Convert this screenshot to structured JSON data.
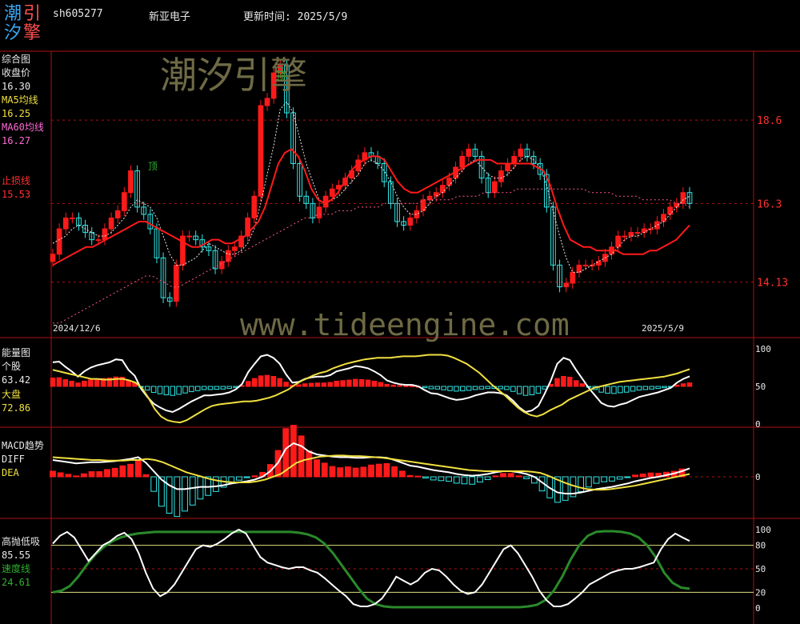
{
  "header": {
    "logo_chars": [
      "潮",
      "引",
      "汐",
      "擎"
    ],
    "code": "sh605277",
    "name": "新亚电子",
    "update": "更新时间: 2025/5/9"
  },
  "watermark": {
    "brand": "潮汐引擎",
    "url": "www.tideengine.com"
  },
  "colors": {
    "bull": "#ff1a1a",
    "bear": "#30e8e8",
    "ma5": "#e8e8e8",
    "ma60": "#ff3030",
    "grid": "#b01010",
    "bg": "#000000"
  },
  "panels": {
    "main": {
      "labels": [
        "综合图",
        "收盘价",
        "16.30",
        "MA5均线",
        "16.25",
        "MA60均线",
        "16.27",
        "止损线",
        "15.53"
      ],
      "top_marks": [
        "顶",
        "顶"
      ],
      "dates": [
        "2024/12/6",
        "2025/5/9"
      ]
    },
    "energy": {
      "labels": [
        "能量图",
        "个股",
        "63.42",
        "大盘",
        "72.86"
      ]
    },
    "macd": {
      "labels": [
        "MACD趋势",
        "DIFF",
        "DEA"
      ]
    },
    "osc": {
      "labels": [
        "高抛低吸",
        "85.55",
        "速度线",
        "24.61"
      ]
    }
  },
  "chart_data": [
    {
      "type": "candlestick",
      "title": "综合图",
      "y_ticks": [
        "18.6",
        "16.3",
        "14.13"
      ],
      "ylim": [
        12.6,
        20.5
      ],
      "x_labels": [
        "2024/12/6",
        "2025/5/9"
      ],
      "closes": [
        14.9,
        15.6,
        15.9,
        15.9,
        15.7,
        15.5,
        15.3,
        15.3,
        15.6,
        15.9,
        16.1,
        16.6,
        17.2,
        16.2,
        16.0,
        15.6,
        14.8,
        13.7,
        13.6,
        14.6,
        15.4,
        15.4,
        15.3,
        15.1,
        15.0,
        14.5,
        14.7,
        15.0,
        15.1,
        15.4,
        15.9,
        16.5,
        19.0,
        19.2,
        19.9,
        20.1,
        18.8,
        17.4,
        16.5,
        16.3,
        15.9,
        16.2,
        16.5,
        16.7,
        16.8,
        17.0,
        17.2,
        17.5,
        17.7,
        17.6,
        17.4,
        16.9,
        16.3,
        15.8,
        15.7,
        15.9,
        16.1,
        16.4,
        16.5,
        16.6,
        16.8,
        17.0,
        17.3,
        17.6,
        17.8,
        17.6,
        17.0,
        16.6,
        16.9,
        17.2,
        17.4,
        17.6,
        17.8,
        17.6,
        17.4,
        17.1,
        16.2,
        14.6,
        14.0,
        14.1,
        14.4,
        14.6,
        14.6,
        14.6,
        14.7,
        14.9,
        15.1,
        15.4,
        15.4,
        15.5,
        15.5,
        15.6,
        15.6,
        15.8,
        16.0,
        16.2,
        16.3,
        16.6,
        16.3
      ],
      "series": [
        {
          "name": "MA5",
          "values": [
            15.2,
            15.3,
            15.4,
            15.6,
            15.7,
            15.6,
            15.5,
            15.4,
            15.4,
            15.5,
            15.7,
            15.9,
            16.2,
            16.4,
            16.3,
            16.2,
            15.9,
            15.4,
            14.9,
            14.6,
            14.6,
            14.7,
            14.8,
            15.0,
            15.2,
            15.1,
            15.0,
            14.9,
            14.9,
            15.0,
            15.2,
            15.6,
            16.3,
            17.1,
            17.9,
            18.9,
            19.1,
            18.8,
            18.1,
            17.4,
            16.9,
            16.4,
            16.3,
            16.4,
            16.5,
            16.7,
            16.9,
            17.1,
            17.4,
            17.5,
            17.4,
            17.2,
            16.9,
            16.5,
            16.2,
            16.0,
            16.0,
            16.1,
            16.3,
            16.5,
            16.6,
            16.8,
            17.0,
            17.2,
            17.4,
            17.5,
            17.3,
            17.1,
            17.0,
            17.0,
            17.1,
            17.3,
            17.5,
            17.6,
            17.5,
            17.3,
            16.8,
            16.1,
            15.4,
            14.8,
            14.4,
            14.4,
            14.5,
            14.6,
            14.7,
            14.8,
            14.9,
            15.1,
            15.3,
            15.4,
            15.4,
            15.5,
            15.6,
            15.7,
            15.8,
            16.0,
            16.2,
            16.4,
            16.5
          ]
        },
        {
          "name": "MA60",
          "values": [
            14.6,
            14.7,
            14.8,
            14.9,
            15.0,
            15.1,
            15.1,
            15.2,
            15.3,
            15.4,
            15.5,
            15.6,
            15.7,
            15.8,
            15.8,
            15.7,
            15.6,
            15.5,
            15.4,
            15.3,
            15.2,
            15.1,
            15.1,
            15.2,
            15.3,
            15.3,
            15.2,
            15.2,
            15.3,
            15.4,
            15.6,
            15.8,
            16.2,
            16.8,
            17.4,
            17.7,
            17.8,
            17.6,
            17.2,
            16.7,
            16.4,
            16.3,
            16.4,
            16.6,
            16.9,
            17.2,
            17.4,
            17.5,
            17.6,
            17.6,
            17.5,
            17.2,
            16.9,
            16.7,
            16.6,
            16.6,
            16.7,
            16.8,
            16.9,
            17.0,
            17.1,
            17.2,
            17.3,
            17.4,
            17.5,
            17.5,
            17.5,
            17.4,
            17.4,
            17.4,
            17.4,
            17.4,
            17.4,
            17.3,
            17.2,
            16.8,
            16.2,
            15.7,
            15.3,
            15.2,
            15.1,
            15.1,
            15.0,
            15.0,
            15.0,
            15.0,
            14.9,
            14.9,
            14.9,
            14.9,
            15.0,
            15.0,
            15.1,
            15.2,
            15.3,
            15.5,
            15.7
          ]
        },
        {
          "name": "Trend",
          "values": [
            13.0,
            13.0,
            13.1,
            13.2,
            13.3,
            13.4,
            13.5,
            13.6,
            13.7,
            13.8,
            13.9,
            14.0,
            14.1,
            14.2,
            14.3,
            14.3,
            14.2,
            14.1,
            14.0,
            14.0,
            14.1,
            14.2,
            14.3,
            14.4,
            14.5,
            14.6,
            14.7,
            14.8,
            14.9,
            15.0,
            15.1,
            15.2,
            15.3,
            15.4,
            15.5,
            15.6,
            15.7,
            15.8,
            15.9,
            15.9,
            16.0,
            16.0,
            16.0,
            16.1,
            16.1,
            16.1,
            16.2,
            16.2,
            16.2,
            16.2,
            16.3,
            16.3,
            16.3,
            16.3,
            16.3,
            16.3,
            16.4,
            16.4,
            16.4,
            16.4,
            16.4,
            16.5,
            16.5,
            16.5,
            16.5,
            16.6,
            16.6,
            16.6,
            16.6,
            16.6,
            16.7,
            16.7,
            16.7,
            16.7,
            16.7,
            16.7,
            16.7,
            16.7,
            16.7,
            16.7,
            16.7,
            16.6,
            16.6,
            16.6,
            16.6,
            16.5,
            16.5,
            16.5,
            16.5,
            16.4,
            16.4,
            16.4,
            16.4,
            16.4,
            16.3,
            16.3,
            16.2
          ]
        }
      ]
    },
    {
      "type": "bar",
      "title": "能量图",
      "y_ticks": [
        "100",
        "50",
        "0"
      ],
      "ylim": [
        0,
        100
      ],
      "series": [
        {
          "name": "个股",
          "values": [
            82,
            83,
            76,
            70,
            63,
            70,
            75,
            78,
            80,
            82,
            86,
            85,
            72,
            64,
            47,
            36,
            27,
            22,
            18,
            16,
            20,
            25,
            30,
            34,
            38,
            38,
            39,
            40,
            42,
            46,
            53,
            69,
            80,
            90,
            92,
            88,
            80,
            66,
            55,
            56,
            60,
            62,
            63,
            63,
            65,
            70,
            72,
            74,
            77,
            76,
            74,
            70,
            65,
            58,
            55,
            53,
            52,
            52,
            50,
            45,
            41,
            40,
            37,
            34,
            32,
            33,
            35,
            38,
            40,
            42,
            42,
            41,
            38,
            31,
            22,
            16,
            18,
            24,
            40,
            58,
            80,
            88,
            85,
            72,
            60,
            48,
            38,
            28,
            24,
            23,
            26,
            28,
            32,
            36,
            38,
            40,
            42,
            45,
            48,
            55,
            60,
            63.42
          ]
        },
        {
          "name": "大盘",
          "values": [
            72,
            70,
            68,
            66,
            64,
            62,
            60,
            60,
            59,
            59,
            60,
            60,
            58,
            55,
            48,
            35,
            20,
            10,
            5,
            3,
            2,
            5,
            10,
            15,
            20,
            24,
            26,
            27,
            28,
            29,
            30,
            30,
            31,
            33,
            35,
            38,
            42,
            46,
            52,
            57,
            61,
            65,
            68,
            70,
            74,
            77,
            80,
            82,
            84,
            86,
            87,
            88,
            88,
            88,
            89,
            90,
            90,
            90,
            91,
            92,
            92,
            92,
            91,
            88,
            84,
            80,
            74,
            68,
            60,
            52,
            45,
            38,
            30,
            22,
            16,
            12,
            10,
            13,
            18,
            22,
            26,
            32,
            36,
            40,
            44,
            48,
            50,
            52,
            54,
            56,
            57,
            58,
            59,
            60,
            61,
            62,
            63,
            65,
            67,
            70,
            72.86
          ]
        }
      ]
    },
    {
      "type": "bar",
      "title": "MACD趋势",
      "y_ticks": [
        "0"
      ],
      "series": [
        {
          "name": "DIFF",
          "values": [
            0.3,
            0.28,
            0.26,
            0.24,
            0.25,
            0.26,
            0.26,
            0.27,
            0.28,
            0.3,
            0.32,
            0.35,
            0.25,
            0.1,
            -0.05,
            -0.15,
            -0.22,
            -0.22,
            -0.2,
            -0.18,
            -0.18,
            -0.17,
            -0.15,
            -0.12,
            -0.1,
            -0.08,
            -0.05,
            0.0,
            0.1,
            0.25,
            0.5,
            0.6,
            0.55,
            0.45,
            0.4,
            0.38,
            0.36,
            0.35,
            0.35,
            0.34,
            0.34,
            0.35,
            0.35,
            0.34,
            0.3,
            0.25,
            0.2,
            0.18,
            0.15,
            0.12,
            0.1,
            0.08,
            0.05,
            0.03,
            0.02,
            0.03,
            0.05,
            0.08,
            0.1,
            0.1,
            0.08,
            0.05,
            0.0,
            -0.1,
            -0.2,
            -0.28,
            -0.3,
            -0.3,
            -0.28,
            -0.25,
            -0.22,
            -0.2,
            -0.18,
            -0.15,
            -0.12,
            -0.08,
            -0.05,
            -0.02,
            0.0,
            0.03,
            0.06,
            0.1,
            0.15
          ]
        },
        {
          "name": "DEA",
          "values": [
            0.35,
            0.34,
            0.33,
            0.32,
            0.31,
            0.3,
            0.3,
            0.29,
            0.29,
            0.29,
            0.3,
            0.3,
            0.32,
            0.3,
            0.26,
            0.2,
            0.14,
            0.08,
            0.04,
            0.0,
            -0.04,
            -0.07,
            -0.09,
            -0.1,
            -0.1,
            -0.1,
            -0.08,
            -0.05,
            0.0,
            0.05,
            0.15,
            0.25,
            0.3,
            0.33,
            0.36,
            0.37,
            0.38,
            0.38,
            0.37,
            0.37,
            0.36,
            0.35,
            0.34,
            0.32,
            0.3,
            0.28,
            0.26,
            0.24,
            0.22,
            0.2,
            0.18,
            0.16,
            0.14,
            0.12,
            0.11,
            0.1,
            0.1,
            0.1,
            0.1,
            0.1,
            0.1,
            0.09,
            0.07,
            0.02,
            -0.04,
            -0.1,
            -0.15,
            -0.19,
            -0.22,
            -0.23,
            -0.23,
            -0.22,
            -0.2,
            -0.18,
            -0.16,
            -0.13,
            -0.1,
            -0.07,
            -0.04,
            -0.01,
            0.02,
            0.05
          ]
        }
      ]
    },
    {
      "type": "line",
      "title": "高抛低吸",
      "y_ticks": [
        "100",
        "80",
        "50",
        "20",
        "0"
      ],
      "ylim": [
        0,
        100
      ],
      "series": [
        {
          "name": "高抛低吸",
          "values": [
            82,
            92,
            97,
            90,
            75,
            60,
            70,
            80,
            85,
            92,
            96,
            88,
            70,
            45,
            25,
            15,
            20,
            30,
            45,
            60,
            75,
            80,
            78,
            82,
            88,
            95,
            100,
            95,
            80,
            65,
            58,
            55,
            52,
            50,
            52,
            52,
            48,
            45,
            38,
            30,
            22,
            15,
            5,
            2,
            2,
            5,
            12,
            25,
            40,
            35,
            30,
            35,
            45,
            50,
            48,
            40,
            30,
            22,
            18,
            20,
            30,
            45,
            60,
            75,
            80,
            70,
            55,
            40,
            22,
            10,
            2,
            2,
            5,
            12,
            20,
            30,
            35,
            40,
            45,
            48,
            50,
            50,
            52,
            55,
            58,
            75,
            88,
            95,
            90,
            85.55
          ]
        },
        {
          "name": "速度线",
          "values": [
            20,
            22,
            28,
            40,
            55,
            68,
            78,
            85,
            90,
            93,
            95,
            96,
            97,
            97,
            97,
            97,
            97,
            97,
            97,
            97,
            97,
            97,
            97,
            97,
            97,
            97,
            97,
            97,
            97,
            96,
            94,
            90,
            82,
            70,
            55,
            40,
            25,
            12,
            5,
            2,
            1,
            1,
            1,
            1,
            1,
            1,
            1,
            1,
            1,
            1,
            1,
            1,
            1,
            1,
            1,
            1,
            2,
            4,
            10,
            22,
            40,
            62,
            80,
            92,
            97,
            98,
            98,
            97,
            95,
            90,
            80,
            65,
            45,
            32,
            26,
            24.61
          ]
        }
      ]
    }
  ]
}
